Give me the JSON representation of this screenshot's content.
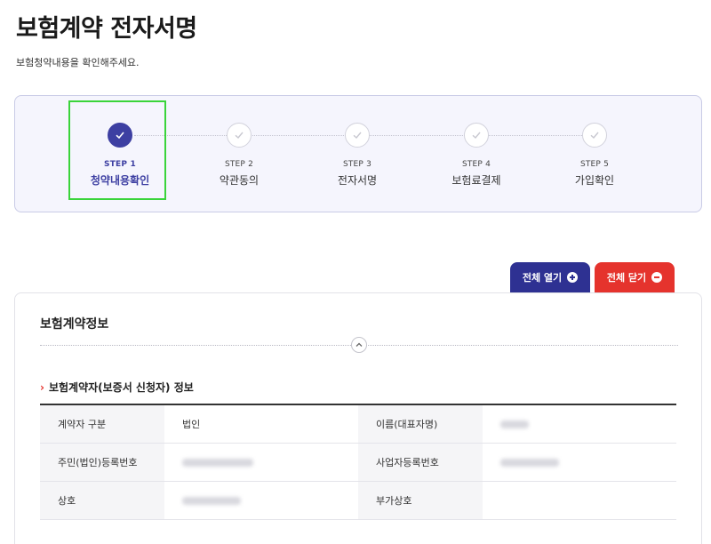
{
  "header": {
    "title": "보험계약 전자서명",
    "subtitle": "보험청약내용을 확인해주세요."
  },
  "stepper": {
    "steps": [
      {
        "num": "STEP 1",
        "label": "청약내용확인",
        "active": true
      },
      {
        "num": "STEP 2",
        "label": "약관동의",
        "active": false
      },
      {
        "num": "STEP 3",
        "label": "전자서명",
        "active": false
      },
      {
        "num": "STEP 4",
        "label": "보험료결제",
        "active": false
      },
      {
        "num": "STEP 5",
        "label": "가입확인",
        "active": false
      }
    ],
    "colors": {
      "active": "#3d3fa2",
      "highlight": "#3ad43a"
    }
  },
  "toolbar": {
    "expand_all_label": "전체 열기",
    "collapse_all_label": "전체 닫기",
    "expand_icon": "plus-circle-icon",
    "collapse_icon": "minus-circle-icon",
    "colors": {
      "expand": "#2e3192",
      "collapse": "#e5332d"
    }
  },
  "contract_info": {
    "section_title": "보험계약정보",
    "subsection_title": "보험계약자(보증서 신청자) 정보",
    "rows": [
      [
        {
          "label": "계약자 구분",
          "value": "법인"
        },
        {
          "label": "이름(대표자명)",
          "value": ""
        }
      ],
      [
        {
          "label": "주민(법인)등록번호",
          "value": ""
        },
        {
          "label": "사업자등록번호",
          "value": ""
        }
      ],
      [
        {
          "label": "상호",
          "value": ""
        },
        {
          "label": "부가상호",
          "value": ""
        }
      ]
    ]
  }
}
